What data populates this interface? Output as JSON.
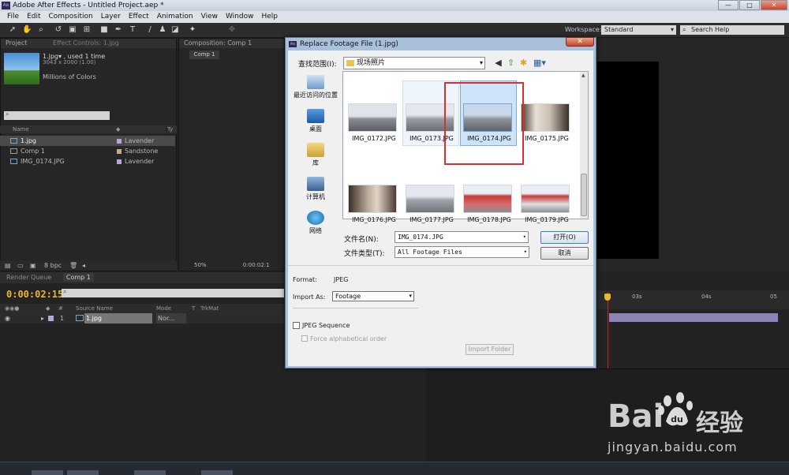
{
  "app": {
    "title": "Adobe After Effects - Untitled Project.aep *"
  },
  "menu": [
    "File",
    "Edit",
    "Composition",
    "Layer",
    "Effect",
    "Animation",
    "View",
    "Window",
    "Help"
  ],
  "toolbar": {
    "workspace_label": "Workspace:",
    "workspace_value": "Standard",
    "search_help": "Search Help"
  },
  "project_panel": {
    "tab_project": "Project",
    "tab_effect_controls": "Effect Controls: 1.jpg",
    "item_name": "1.jpg▾ , used 1 time",
    "item_dims": "3043 x 2000 (1.00)",
    "item_colors": "Millions of Colors",
    "col_name": "Name",
    "col_type": "Ty",
    "rows": [
      {
        "name": "1.jpg",
        "label": "Lavender",
        "color": "#b4a8d8"
      },
      {
        "name": "Comp 1",
        "label": "Sandstone",
        "color": "#c8aa80"
      },
      {
        "name": "IMG_0174.JPG",
        "label": "Lavender",
        "color": "#b4a8d8"
      }
    ],
    "bpc": "8 bpc"
  },
  "comp_panel": {
    "tab": "Composition: Comp 1",
    "subtab": "Comp 1",
    "zoom": "50%",
    "time": "0:00:02:1"
  },
  "timeline": {
    "tab_render": "Render Queue",
    "tab_comp": "Comp 1",
    "timecode": "0:00:02:15",
    "col_source": "Source Name",
    "col_mode": "Mode",
    "col_t": "T",
    "col_trkmat": "TrkMat",
    "layer_num": "1",
    "layer_name": "1.jpg",
    "layer_mode": "Nor...",
    "ruler_03": "03s",
    "ruler_04": "04s",
    "ruler_05": "05"
  },
  "dialog": {
    "title": "Replace Footage File (1.jpg)",
    "close": "✕",
    "lookin_label": "查找范围(I):",
    "lookin_value": "现场照片",
    "places": [
      "最近访问的位置",
      "桌面",
      "库",
      "计算机",
      "网络"
    ],
    "files": [
      "IMG_0172.JPG",
      "IMG_0173.JPG",
      "IMG_0174.JPG",
      "IMG_0175.JPG",
      "IMG_0176.JPG",
      "IMG_0177.JPG",
      "IMG_0178.JPG",
      "IMG_0179.JPG"
    ],
    "filename_label": "文件名(N):",
    "filename_value": "IMG_0174.JPG",
    "filetype_label": "文件类型(T):",
    "filetype_value": "All Footage Files",
    "open_btn": "打开(O)",
    "cancel_btn": "取消",
    "format_label": "Format:",
    "format_value": "JPEG",
    "importas_label": "Import As:",
    "importas_value": "Footage",
    "jpeg_sequence": "JPEG Sequence",
    "force_alpha": "Force alphabetical order",
    "import_folder": "Import Folder"
  },
  "watermark": {
    "brand": "Bai",
    "brand_cn": "经验",
    "url": "jingyan.baidu.com"
  }
}
